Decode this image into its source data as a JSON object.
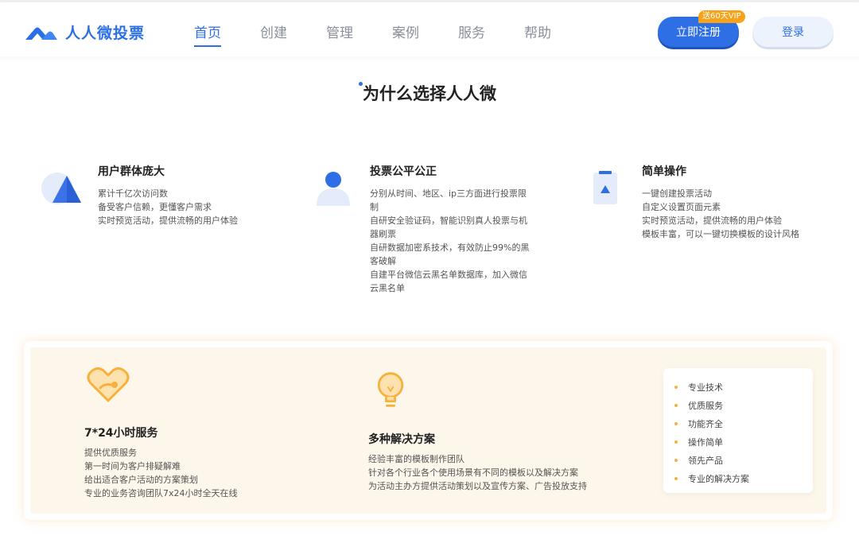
{
  "brand": {
    "name": "人人微投票",
    "color": "#2b6fe5"
  },
  "nav": {
    "items": [
      {
        "label": "首页",
        "active": true
      },
      {
        "label": "创建",
        "active": false
      },
      {
        "label": "管理",
        "active": false
      },
      {
        "label": "案例",
        "active": false
      },
      {
        "label": "服务",
        "active": false
      },
      {
        "label": "帮助",
        "active": false
      }
    ]
  },
  "actions": {
    "register_label": "立即注册",
    "vip_badge": "送60天VIP",
    "login_label": "登录"
  },
  "why": {
    "title": "为什么选择人人微",
    "features": [
      {
        "icon": "pyramid-icon",
        "title": "用户群体庞大",
        "lines": [
          "累计千亿次访问数",
          "备受客户信赖，更懂客户需求",
          "实时预览活动，提供流畅的用户体验"
        ]
      },
      {
        "icon": "user-icon",
        "title": "投票公平公正",
        "lines": [
          "分别从时间、地区、ip三方面进行投票限",
          "制",
          "自研安全验证码，智能识别真人投票与机",
          "器刷票",
          "自研数据加密系技术，有效防止99%的黑",
          "客破解",
          "自建平台微信云黑名单数据库，加入微信",
          "云黑名单"
        ]
      },
      {
        "icon": "phone-icon",
        "title": "简单操作",
        "lines": [
          "一键创建投票活动",
          "自定义设置页面元素",
          "实时预览活动，提供流畅的用户体验",
          "模板丰富，可以一键切换模板的设计风格"
        ]
      }
    ]
  },
  "services": {
    "items": [
      {
        "icon": "heart-icon",
        "title": "7*24小时服务",
        "lines": [
          "提供优质服务",
          "第一时间为客户排疑解难",
          "给出适合客户活动的方案策划",
          "专业的业务咨询团队7x24小时全天在线"
        ]
      },
      {
        "icon": "lightbulb-icon",
        "title": "多种解决方案",
        "lines": [
          "经验丰富的模板制作团队",
          "针对各个行业各个使用场景有不同的模板以及解决方案",
          "为活动主办方提供活动策划以及宣传方案、广告投放支持"
        ]
      }
    ],
    "list": [
      "专业技术",
      "优质服务",
      "功能齐全",
      "操作简单",
      "领先产品",
      "专业的解决方案"
    ]
  }
}
